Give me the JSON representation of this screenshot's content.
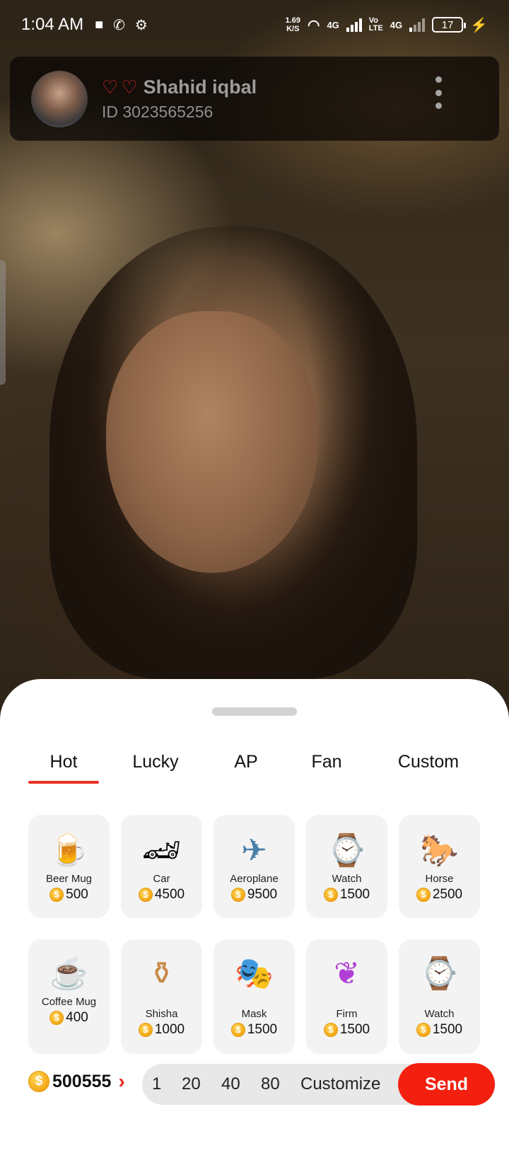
{
  "status_bar": {
    "time": "1:04 AM",
    "net_speed_value": "1.69",
    "net_speed_unit": "K/S",
    "network_1": "4G",
    "network_2_top": "Vo",
    "network_2_bottom": "LTE",
    "network_3": "4G",
    "battery": "17"
  },
  "profile": {
    "name": "Shahid iqbal",
    "id_text": "ID 3023565256"
  },
  "tabs": [
    {
      "label": "Hot",
      "active": true
    },
    {
      "label": "Lucky",
      "active": false
    },
    {
      "label": "AP",
      "active": false
    },
    {
      "label": "Fan",
      "active": false
    },
    {
      "label": "Custom",
      "active": false
    }
  ],
  "gifts": [
    {
      "name": "Beer Mug",
      "price": "500",
      "icon": "beer-mug-icon",
      "glyph": "🍺"
    },
    {
      "name": "Car",
      "price": "4500",
      "icon": "car-icon",
      "glyph": "🏎"
    },
    {
      "name": "Aeroplane",
      "price": "9500",
      "icon": "aeroplane-icon",
      "glyph": "✈"
    },
    {
      "name": "Watch",
      "price": "1500",
      "icon": "watch-icon",
      "glyph": "⌚"
    },
    {
      "name": "Horse",
      "price": "2500",
      "icon": "horse-icon",
      "glyph": "🐎"
    },
    {
      "name": "Coffee Mug",
      "price": "400",
      "icon": "coffee-mug-icon",
      "glyph": "☕"
    },
    {
      "name": "Shisha",
      "price": "1000",
      "icon": "shisha-icon",
      "glyph": "⚱"
    },
    {
      "name": "Mask",
      "price": "1500",
      "icon": "mask-icon",
      "glyph": "🎭"
    },
    {
      "name": "Firm",
      "price": "1500",
      "icon": "firm-icon",
      "glyph": "❦"
    },
    {
      "name": "Watch",
      "price": "1500",
      "icon": "watch-icon",
      "glyph": "⌚"
    }
  ],
  "balance": "500555",
  "quantities": [
    "1",
    "20",
    "40",
    "80",
    "Customize"
  ],
  "send_label": "Send",
  "colors": {
    "accent": "#f3200f",
    "tab_underline": "#ea2f24",
    "coin": "#f2a10e"
  }
}
